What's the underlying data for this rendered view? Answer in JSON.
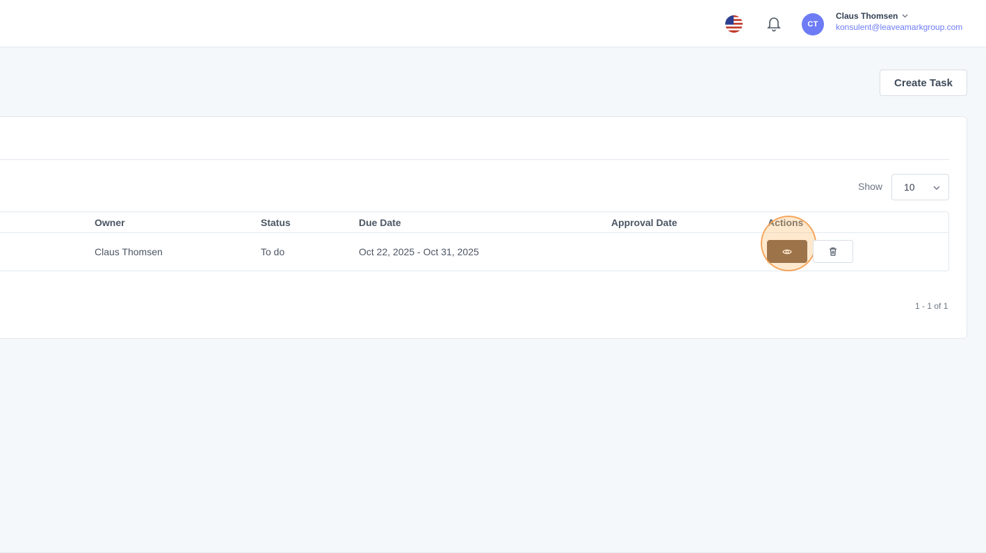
{
  "header": {
    "language_flag": "us-flag-icon",
    "notification_icon": "bell-icon",
    "user": {
      "initials": "CT",
      "name": "Claus Thomsen",
      "email": "konsulent@leaveamarkgroup.com",
      "avatar_color": "#6d7cf5",
      "email_color": "#6d7cf5"
    }
  },
  "toolbar": {
    "create_label": "Create Task"
  },
  "table": {
    "show_label": "Show",
    "page_size": "10",
    "columns": {
      "owner": "Owner",
      "status": "Status",
      "due_date": "Due Date",
      "approval_date": "Approval Date",
      "actions": "Actions"
    },
    "rows": [
      {
        "owner": "Claus Thomsen",
        "status": "To do",
        "due_date": "Oct 22, 2025 - Oct 31, 2025",
        "approval_date": ""
      }
    ],
    "pagination": "1 - 1 of 1"
  },
  "colors": {
    "view_button": "#6b4a35",
    "click_highlight": "#f59e50"
  }
}
